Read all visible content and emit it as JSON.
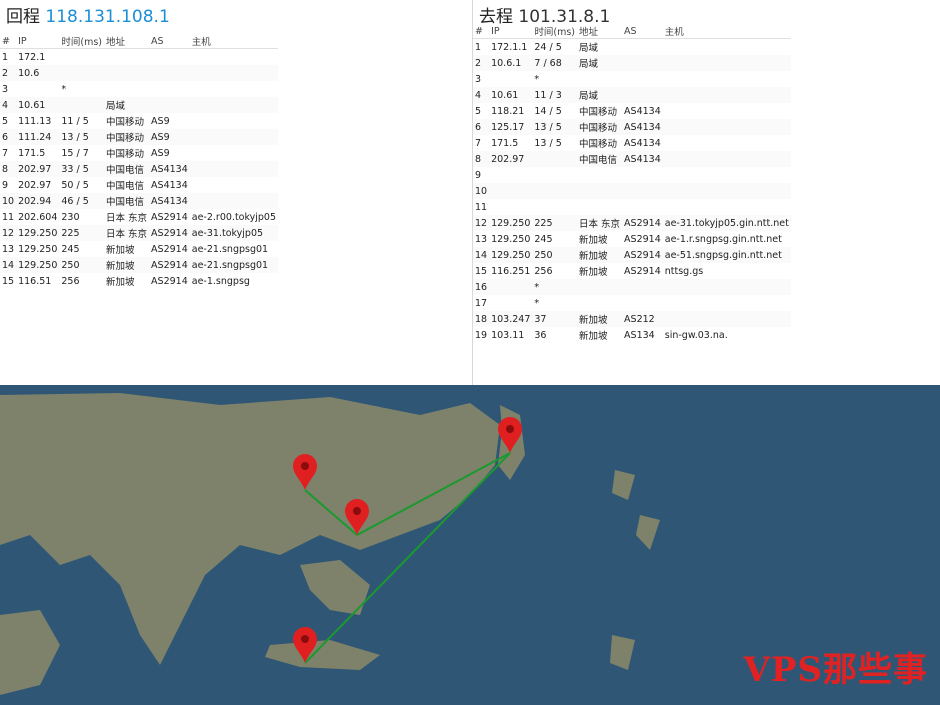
{
  "left": {
    "title_prefix": "回程",
    "title_ip": "118.131.108.1",
    "headers": [
      "#",
      "IP",
      "时间(ms)",
      "地址",
      "AS",
      "主机"
    ],
    "rows": [
      [
        "1",
        "172.1",
        "",
        "",
        "",
        ""
      ],
      [
        "2",
        "10.6",
        "",
        "",
        "",
        ""
      ],
      [
        "3",
        "",
        "*",
        "",
        "",
        ""
      ],
      [
        "4",
        "10.61",
        "",
        "局域",
        "",
        ""
      ],
      [
        "5",
        "111.13",
        "11 / 5",
        "中国移动",
        "AS9",
        ""
      ],
      [
        "6",
        "111.24",
        "13 / 5",
        "中国移动",
        "AS9",
        ""
      ],
      [
        "7",
        "171.5",
        "15 / 7",
        "中国移动",
        "AS9",
        ""
      ],
      [
        "8",
        "202.97",
        "33 / 5",
        "中国电信",
        "AS4134",
        ""
      ],
      [
        "9",
        "202.97",
        "50 / 5",
        "中国电信",
        "AS4134",
        ""
      ],
      [
        "10",
        "202.94",
        "46 / 5",
        "中国电信",
        "AS4134",
        ""
      ],
      [
        "11",
        "202.604",
        "230",
        "日本 东京",
        "AS2914",
        "ae-2.r00.tokyjp05"
      ],
      [
        "12",
        "129.250",
        "225",
        "日本 东京",
        "AS2914",
        "ae-31.tokyjp05"
      ],
      [
        "13",
        "129.250",
        "245",
        "新加坡",
        "AS2914",
        "ae-21.sngpsg01"
      ],
      [
        "14",
        "129.250",
        "250",
        "新加坡",
        "AS2914",
        "ae-21.sngpsg01"
      ],
      [
        "15",
        "116.51",
        "256",
        "新加坡",
        "AS2914",
        "ae-1.sngpsg"
      ]
    ]
  },
  "right": {
    "title_prefix": "去程",
    "title_ip": "101.31.8.1",
    "headers": [
      "#",
      "IP",
      "时间(ms)",
      "地址",
      "AS",
      "主机"
    ],
    "rows": [
      [
        "1",
        "172.1.1",
        "24 / 5",
        "局域",
        "",
        ""
      ],
      [
        "2",
        "10.6.1",
        "7 / 68",
        "局域",
        "",
        ""
      ],
      [
        "3",
        "",
        "*",
        "",
        "",
        ""
      ],
      [
        "4",
        "10.61",
        "11 / 3",
        "局域",
        "",
        ""
      ],
      [
        "5",
        "118.21",
        "14 / 5",
        "中国移动",
        "AS4134",
        ""
      ],
      [
        "6",
        "125.17",
        "13 / 5",
        "中国移动",
        "AS4134",
        ""
      ],
      [
        "7",
        "171.5",
        "13 / 5",
        "中国移动",
        "AS4134",
        ""
      ],
      [
        "8",
        "202.97",
        "",
        "中国电信",
        "AS4134",
        ""
      ],
      [
        "9",
        "",
        "",
        "",
        "",
        ""
      ],
      [
        "10",
        "",
        "",
        "",
        "",
        ""
      ],
      [
        "11",
        "",
        "",
        "",
        "",
        ""
      ],
      [
        "12",
        "129.250",
        "225",
        "日本 东京",
        "AS2914",
        "ae-31.tokyjp05.gin.ntt.net"
      ],
      [
        "13",
        "129.250",
        "245",
        "新加坡",
        "AS2914",
        "ae-1.r.sngpsg.gin.ntt.net"
      ],
      [
        "14",
        "129.250",
        "250",
        "新加坡",
        "AS2914",
        "ae-51.sngpsg.gin.ntt.net"
      ],
      [
        "15",
        "116.251",
        "256",
        "新加坡",
        "AS2914",
        "nttsg.gs"
      ],
      [
        "16",
        "",
        "*",
        "",
        "",
        ""
      ],
      [
        "17",
        "",
        "*",
        "",
        "",
        ""
      ],
      [
        "18",
        "103.247",
        "37",
        "新加坡",
        "AS212",
        ""
      ],
      [
        "19",
        "103.11",
        "36",
        "新加坡",
        "AS134",
        "sin-gw.03.na."
      ]
    ]
  },
  "map": {
    "watermark": "VPS那些事",
    "route_color": "#1a9a2e",
    "pin_color": "#e02020",
    "land_color": "#8c8a6a",
    "sea_color": "#2f5775"
  }
}
